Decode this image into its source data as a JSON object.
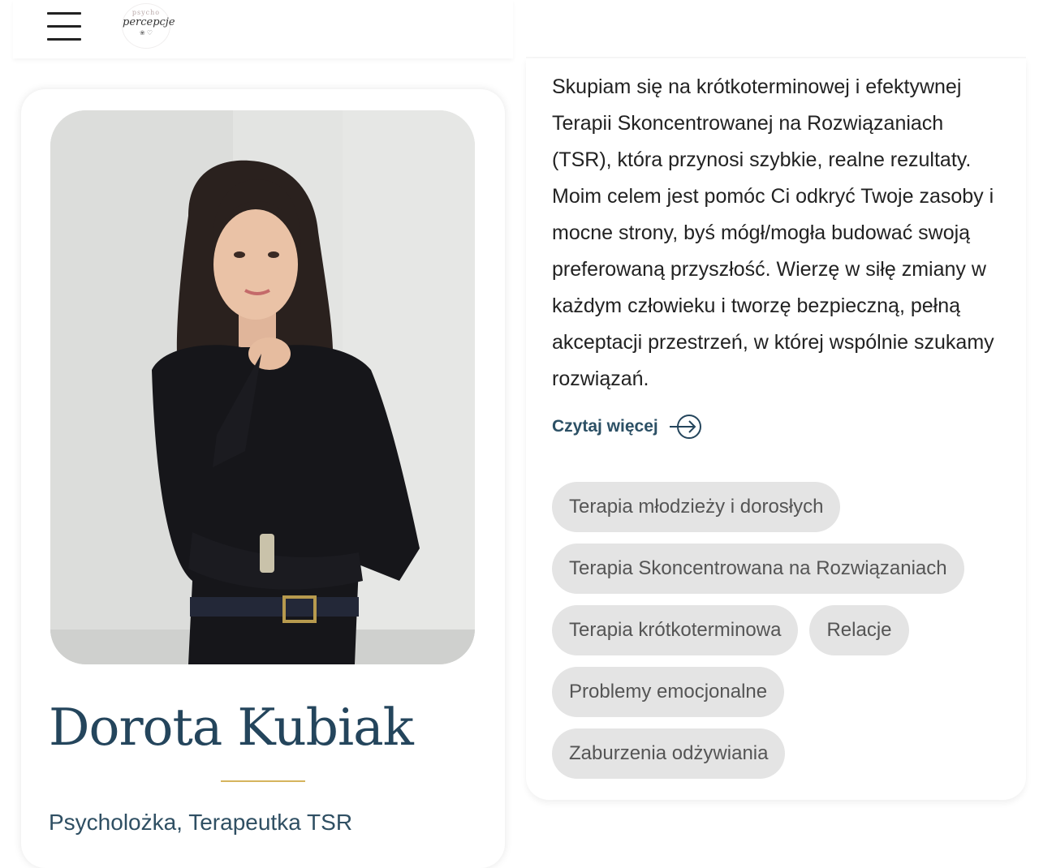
{
  "header": {
    "logo": {
      "small_text": "psycho",
      "main_text": "percepcje",
      "marks": "❀ ♡"
    }
  },
  "profile": {
    "name": "Dorota Kubiak",
    "role": "Psycholożka, Terapeutka TSR",
    "divider_color": "#d5b45d"
  },
  "about": {
    "bio": "Skupiam się na krótkoterminowej i efektywnej Terapii Skoncentrowanej na Rozwiązaniach (TSR), która przynosi szybkie, realne rezultaty. Moim celem jest pomóc Ci odkryć Twoje zasoby i mocne strony, byś mógł/mogła budować swoją preferowaną przyszłość. Wierzę w siłę zmiany w każdym człowieku i tworzę bezpieczną, pełną akceptacji przestrzeń, w której wspólnie szukamy rozwiązań.",
    "read_more": "Czytaj więcej",
    "tags": [
      "Terapia młodzieży i dorosłych",
      "Terapia Skoncentrowana na Rozwiązaniach",
      "Terapia krótkoterminowa",
      "Relacje",
      "Problemy emocjonalne",
      "Zaburzenia odżywiania"
    ]
  },
  "colors": {
    "accent": "#24455c",
    "tag_bg": "#e4e4e4",
    "tag_text": "#555555"
  },
  "icons": [
    "hamburger-menu-icon",
    "arrow-right-circle-icon"
  ]
}
